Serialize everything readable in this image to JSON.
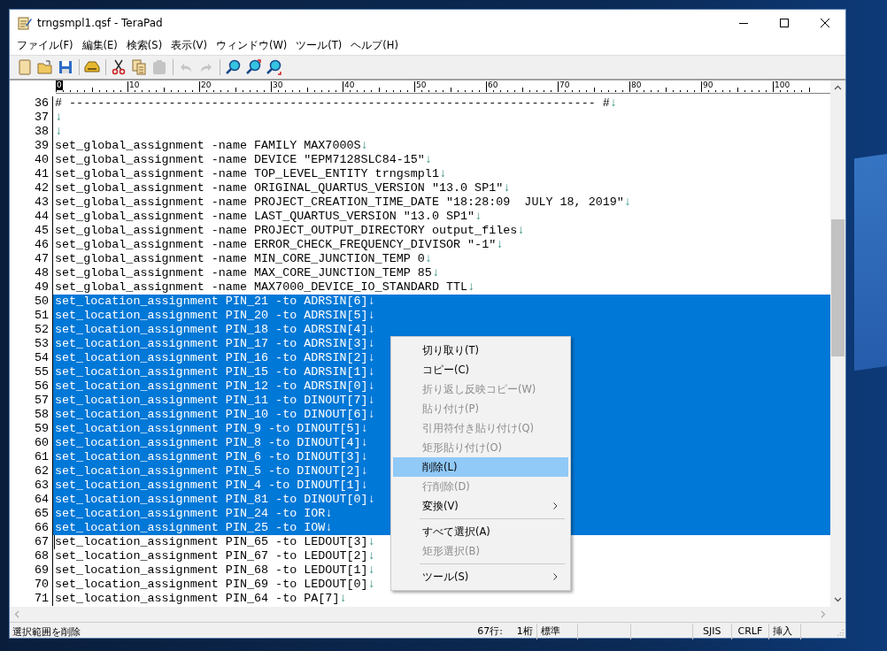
{
  "window": {
    "title": "trngsmpl1.qsf - TeraPad"
  },
  "menu": [
    "ファイル(F)",
    "編集(E)",
    "検索(S)",
    "表示(V)",
    "ウィンドウ(W)",
    "ツール(T)",
    "ヘルプ(H)"
  ],
  "toolbar": [
    {
      "kind": "new",
      "disabled": false
    },
    {
      "kind": "open",
      "disabled": false
    },
    {
      "kind": "save",
      "disabled": false
    },
    {
      "kind": "sep"
    },
    {
      "kind": "print",
      "disabled": false
    },
    {
      "kind": "sep"
    },
    {
      "kind": "cut",
      "disabled": false
    },
    {
      "kind": "copy",
      "disabled": false
    },
    {
      "kind": "paste",
      "disabled": true
    },
    {
      "kind": "sep"
    },
    {
      "kind": "undo",
      "disabled": true
    },
    {
      "kind": "redo",
      "disabled": true
    },
    {
      "kind": "sep"
    },
    {
      "kind": "find",
      "disabled": false
    },
    {
      "kind": "find-next",
      "disabled": false
    },
    {
      "kind": "find-prev",
      "disabled": false
    }
  ],
  "ruler": [
    {
      "label": "0",
      "current": true
    },
    {
      "label": "10",
      "current": false
    },
    {
      "label": "20",
      "current": false
    },
    {
      "label": "30",
      "current": false
    },
    {
      "label": "40",
      "current": false
    },
    {
      "label": "50",
      "current": false
    },
    {
      "label": "60",
      "current": false
    },
    {
      "label": "70",
      "current": false
    },
    {
      "label": "80",
      "current": false
    },
    {
      "label": "90",
      "current": false
    },
    {
      "label": "100",
      "current": false
    }
  ],
  "lines": [
    {
      "number": "36",
      "text": "# -------------------------------------------------------------------------- #",
      "eol": "↓",
      "selected": false,
      "caret": false
    },
    {
      "number": "37",
      "eol": "↓",
      "selected": false,
      "caret": false
    },
    {
      "number": "38",
      "eol": "↓",
      "selected": false,
      "caret": false
    },
    {
      "number": "39",
      "text": "set_global_assignment -name FAMILY MAX7000S",
      "eol": "↓",
      "selected": false,
      "caret": false
    },
    {
      "number": "40",
      "text": "set_global_assignment -name DEVICE \"EPM7128SLC84-15\"",
      "eol": "↓",
      "selected": false,
      "caret": false
    },
    {
      "number": "41",
      "text": "set_global_assignment -name TOP_LEVEL_ENTITY trngsmpl1",
      "eol": "↓",
      "selected": false,
      "caret": false
    },
    {
      "number": "42",
      "text": "set_global_assignment -name ORIGINAL_QUARTUS_VERSION \"13.0 SP1\"",
      "eol": "↓",
      "selected": false,
      "caret": false
    },
    {
      "number": "43",
      "text": "set_global_assignment -name PROJECT_CREATION_TIME_DATE \"18:28:09  JULY 18, 2019\"",
      "eol": "↓",
      "selected": false,
      "caret": false
    },
    {
      "number": "44",
      "text": "set_global_assignment -name LAST_QUARTUS_VERSION \"13.0 SP1\"",
      "eol": "↓",
      "selected": false,
      "caret": false
    },
    {
      "number": "45",
      "text": "set_global_assignment -name PROJECT_OUTPUT_DIRECTORY output_files",
      "eol": "↓",
      "selected": false,
      "caret": false
    },
    {
      "number": "46",
      "text": "set_global_assignment -name ERROR_CHECK_FREQUENCY_DIVISOR \"-1\"",
      "eol": "↓",
      "selected": false,
      "caret": false
    },
    {
      "number": "47",
      "text": "set_global_assignment -name MIN_CORE_JUNCTION_TEMP 0",
      "eol": "↓",
      "selected": false,
      "caret": false
    },
    {
      "number": "48",
      "text": "set_global_assignment -name MAX_CORE_JUNCTION_TEMP 85",
      "eol": "↓",
      "selected": false,
      "caret": false
    },
    {
      "number": "49",
      "text": "set_global_assignment -name MAX7000_DEVICE_IO_STANDARD TTL",
      "eol": "↓",
      "selected": false,
      "caret": false
    },
    {
      "number": "50",
      "text": "set_location_assignment PIN_21 -to ADRSIN[6]",
      "eol": "↓",
      "selected": true,
      "caret": false
    },
    {
      "number": "51",
      "text": "set_location_assignment PIN_20 -to ADRSIN[5]",
      "eol": "↓",
      "selected": true,
      "caret": false
    },
    {
      "number": "52",
      "text": "set_location_assignment PIN_18 -to ADRSIN[4]",
      "eol": "↓",
      "selected": true,
      "caret": false
    },
    {
      "number": "53",
      "text": "set_location_assignment PIN_17 -to ADRSIN[3]",
      "eol": "↓",
      "selected": true,
      "caret": false
    },
    {
      "number": "54",
      "text": "set_location_assignment PIN_16 -to ADRSIN[2]",
      "eol": "↓",
      "selected": true,
      "caret": false
    },
    {
      "number": "55",
      "text": "set_location_assignment PIN_15 -to ADRSIN[1]",
      "eol": "↓",
      "selected": true,
      "caret": false
    },
    {
      "number": "56",
      "text": "set_location_assignment PIN_12 -to ADRSIN[0]",
      "eol": "↓",
      "selected": true,
      "caret": false
    },
    {
      "number": "57",
      "text": "set_location_assignment PIN_11 -to DINOUT[7]",
      "eol": "↓",
      "selected": true,
      "caret": false
    },
    {
      "number": "58",
      "text": "set_location_assignment PIN_10 -to DINOUT[6]",
      "eol": "↓",
      "selected": true,
      "caret": false
    },
    {
      "number": "59",
      "text": "set_location_assignment PIN_9 -to DINOUT[5]",
      "eol": "↓",
      "selected": true,
      "caret": false
    },
    {
      "number": "60",
      "text": "set_location_assignment PIN_8 -to DINOUT[4]",
      "eol": "↓",
      "selected": true,
      "caret": false
    },
    {
      "number": "61",
      "text": "set_location_assignment PIN_6 -to DINOUT[3]",
      "eol": "↓",
      "selected": true,
      "caret": false
    },
    {
      "number": "62",
      "text": "set_location_assignment PIN_5 -to DINOUT[2]",
      "eol": "↓",
      "selected": true,
      "caret": false
    },
    {
      "number": "63",
      "text": "set_location_assignment PIN_4 -to DINOUT[1]",
      "eol": "↓",
      "selected": true,
      "caret": false
    },
    {
      "number": "64",
      "text": "set_location_assignment PIN_81 -to DINOUT[0]",
      "eol": "↓",
      "selected": true,
      "caret": false
    },
    {
      "number": "65",
      "text": "set_location_assignment PIN_24 -to IOR",
      "eol": "↓",
      "selected": true,
      "caret": false
    },
    {
      "number": "66",
      "text": "set_location_assignment PIN_25 -to IOW",
      "eol": "↓",
      "selected": true,
      "caret": false
    },
    {
      "number": "67",
      "text": "set_location_assignment PIN_65 -to LEDOUT[3]",
      "eol": "↓",
      "selected": false,
      "caret": true
    },
    {
      "number": "68",
      "text": "set_location_assignment PIN_67 -to LEDOUT[2]",
      "eol": "↓",
      "selected": false,
      "caret": false
    },
    {
      "number": "69",
      "text": "set_location_assignment PIN_68 -to LEDOUT[1]",
      "eol": "↓",
      "selected": false,
      "caret": false
    },
    {
      "number": "70",
      "text": "set_location_assignment PIN_69 -to LEDOUT[0]",
      "eol": "↓",
      "selected": false,
      "caret": false
    },
    {
      "number": "71",
      "text": "set_location_assignment PIN_64 -to PA[7]",
      "eol": "↓",
      "selected": false,
      "caret": false
    }
  ],
  "context_menu": [
    {
      "kind": "item",
      "label": "切り取り(T)",
      "disabled": false,
      "selected": false,
      "submenu": false
    },
    {
      "kind": "item",
      "label": "コピー(C)",
      "disabled": false,
      "selected": false,
      "submenu": false
    },
    {
      "kind": "item",
      "label": "折り返し反映コピー(W)",
      "disabled": true,
      "selected": false,
      "submenu": false
    },
    {
      "kind": "item",
      "label": "貼り付け(P)",
      "disabled": true,
      "selected": false,
      "submenu": false
    },
    {
      "kind": "item",
      "label": "引用符付き貼り付け(Q)",
      "disabled": true,
      "selected": false,
      "submenu": false
    },
    {
      "kind": "item",
      "label": "矩形貼り付け(O)",
      "disabled": true,
      "selected": false,
      "submenu": false
    },
    {
      "kind": "item",
      "label": "削除(L)",
      "disabled": false,
      "selected": true,
      "submenu": false
    },
    {
      "kind": "item",
      "label": "行削除(D)",
      "disabled": true,
      "selected": false,
      "submenu": false
    },
    {
      "kind": "item",
      "label": "変換(V)",
      "disabled": false,
      "selected": false,
      "submenu": true
    },
    {
      "kind": "separator"
    },
    {
      "kind": "item",
      "label": "すべて選択(A)",
      "disabled": false,
      "selected": false,
      "submenu": false
    },
    {
      "kind": "item",
      "label": "矩形選択(B)",
      "disabled": true,
      "selected": false,
      "submenu": false
    },
    {
      "kind": "separator"
    },
    {
      "kind": "item",
      "label": "ツール(S)",
      "disabled": false,
      "selected": false,
      "submenu": true
    }
  ],
  "status_bar": {
    "message": "選択範囲を削除",
    "cells": [
      "67行:",
      "1桁",
      "標準",
      "",
      "",
      "SJIS",
      "CRLF",
      "挿入",
      ""
    ]
  }
}
